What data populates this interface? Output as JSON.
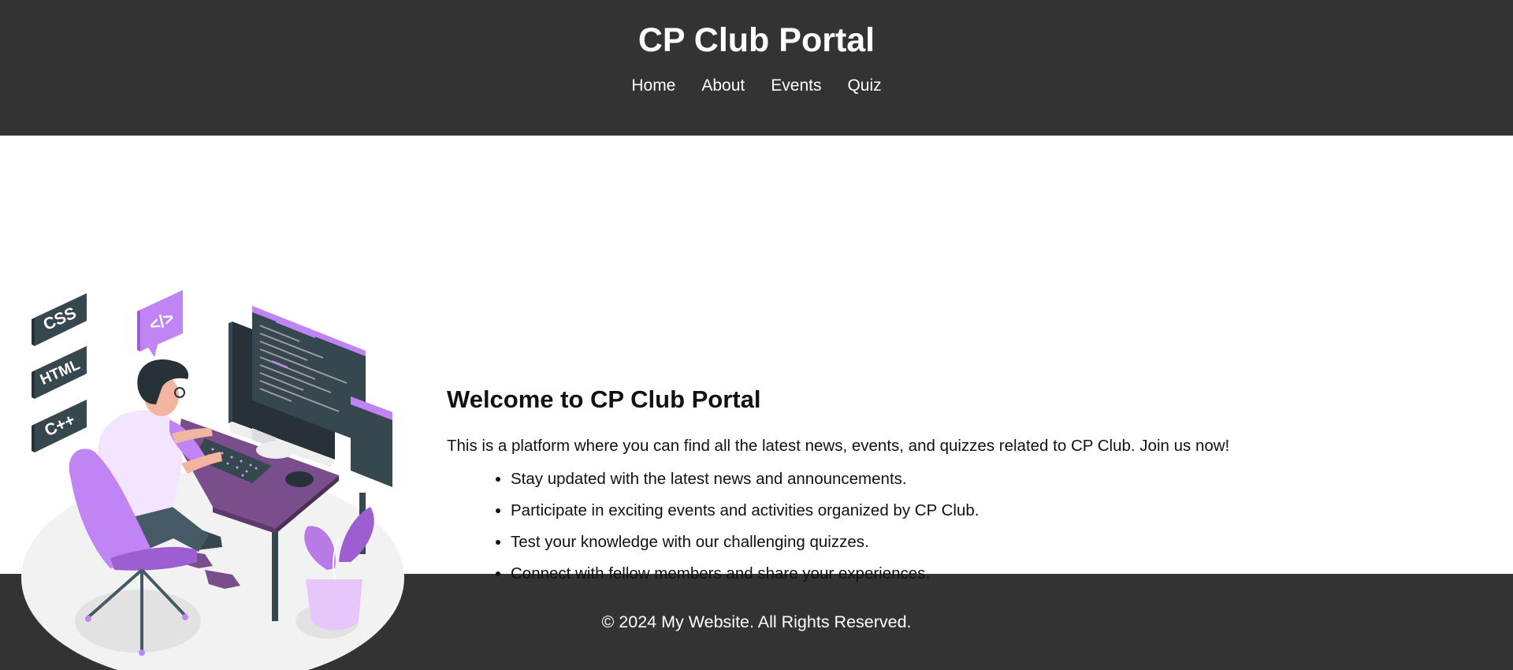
{
  "header": {
    "title": "CP Club Portal",
    "nav": [
      {
        "label": "Home"
      },
      {
        "label": "About"
      },
      {
        "label": "Events"
      },
      {
        "label": "Quiz"
      }
    ]
  },
  "hero": {
    "illustration": {
      "badges": [
        "CSS",
        "HTML",
        "C++"
      ],
      "code_bubble": "</>"
    },
    "title": "Welcome to CP Club Portal",
    "text": "This is a platform where you can find all the latest news, events, and quizzes related to CP Club. Join us now!",
    "features": [
      "Stay updated with the latest news and announcements.",
      "Participate in exciting events and activities organized by CP Club.",
      "Test your knowledge with our challenging quizzes.",
      "Connect with fellow members and share your experiences."
    ]
  },
  "footer": {
    "text": "© 2024 My Website. All Rights Reserved."
  },
  "colors": {
    "header_bg": "#333333",
    "accent_purple": "#b97ae8",
    "desk_purple": "#7a4d8c",
    "dark_slate": "#37474f"
  }
}
